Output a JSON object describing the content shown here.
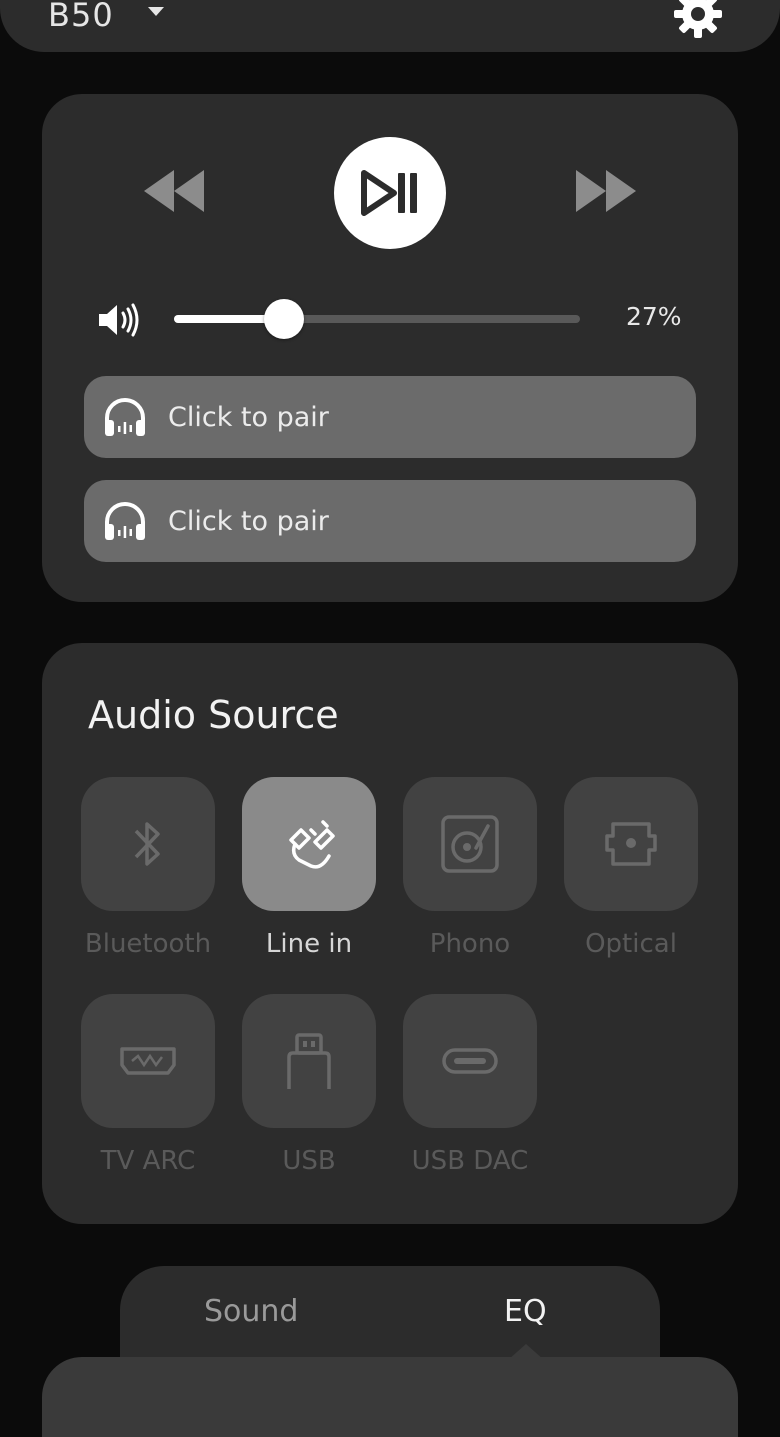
{
  "header": {
    "device_name": "B50"
  },
  "player": {
    "volume": {
      "percent": 27,
      "label": "27%"
    },
    "pair_buttons": [
      {
        "label": "Click to pair"
      },
      {
        "label": "Click to pair"
      }
    ]
  },
  "audio_source": {
    "title": "Audio Source",
    "selected": "Line in",
    "sources": [
      {
        "label": "Bluetooth",
        "icon": "bluetooth-icon",
        "active": false
      },
      {
        "label": "Line in",
        "icon": "line-in-cable-icon",
        "active": true
      },
      {
        "label": "Phono",
        "icon": "turntable-icon",
        "active": false
      },
      {
        "label": "Optical",
        "icon": "optical-port-icon",
        "active": false
      },
      {
        "label": "TV ARC",
        "icon": "hdmi-port-icon",
        "active": false
      },
      {
        "label": "USB",
        "icon": "usb-icon",
        "active": false
      },
      {
        "label": "USB DAC",
        "icon": "usb-c-icon",
        "active": false
      }
    ]
  },
  "tabs": [
    {
      "label": "Sound",
      "active": false
    },
    {
      "label": "EQ",
      "active": true
    }
  ],
  "colors": {
    "background": "#0b0b0b",
    "card": "#2c2c2c",
    "tile": "#424242",
    "tile_active": "#8a8a8a",
    "pair_button": "#6b6b6b",
    "accent": "#ffffff"
  }
}
